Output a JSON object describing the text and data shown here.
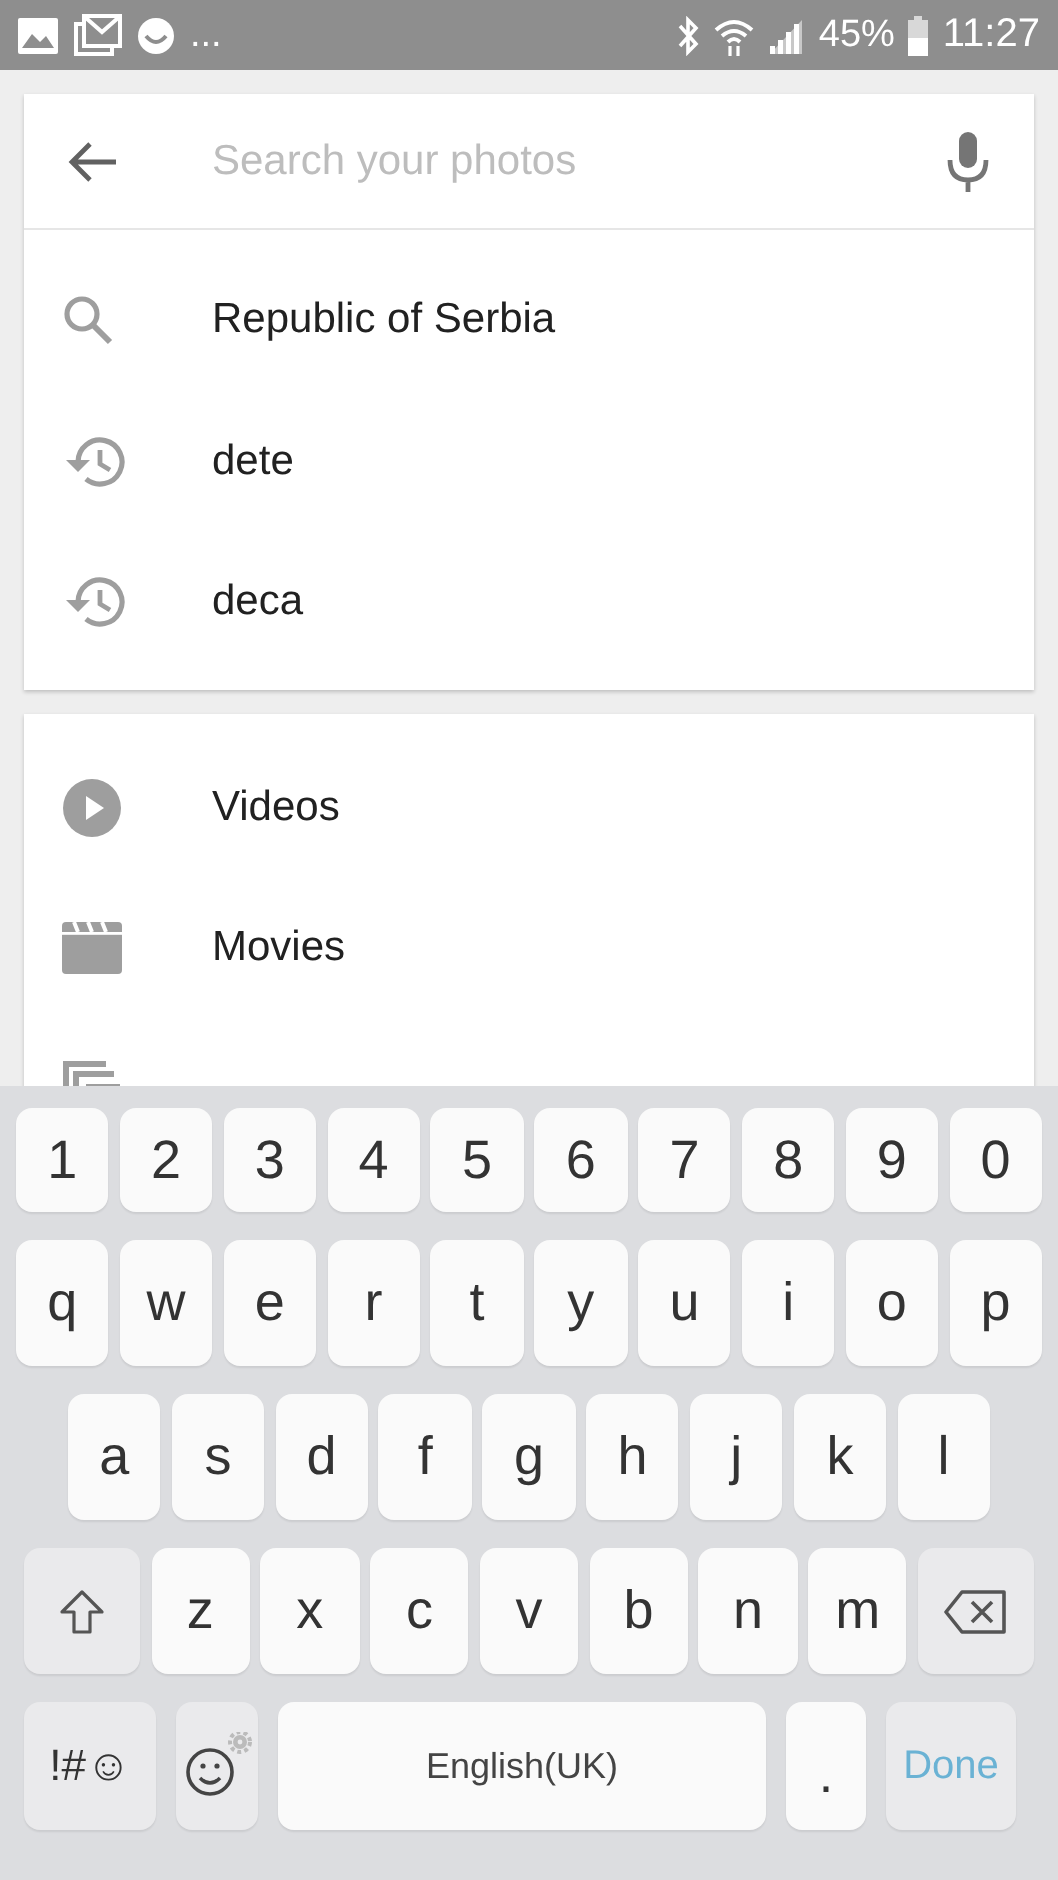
{
  "status_bar": {
    "more": "...",
    "battery": "45%",
    "time": "11:27"
  },
  "search": {
    "placeholder": "Search your photos"
  },
  "suggestions": [
    {
      "kind": "search",
      "text": "Republic of Serbia"
    },
    {
      "kind": "history",
      "text": "dete"
    },
    {
      "kind": "history",
      "text": "deca"
    }
  ],
  "categories": [
    {
      "kind": "video",
      "text": "Videos"
    },
    {
      "kind": "movie",
      "text": "Movies"
    },
    {
      "kind": "animation"
    }
  ],
  "keyboard": {
    "rows": [
      [
        {
          "kind": "char",
          "text": "1"
        },
        {
          "kind": "char",
          "text": "2"
        },
        {
          "kind": "char",
          "text": "3"
        },
        {
          "kind": "char",
          "text": "4"
        },
        {
          "kind": "char",
          "text": "5"
        },
        {
          "kind": "char",
          "text": "6"
        },
        {
          "kind": "char",
          "text": "7"
        },
        {
          "kind": "char",
          "text": "8"
        },
        {
          "kind": "char",
          "text": "9"
        },
        {
          "kind": "char",
          "text": "0"
        }
      ],
      [
        {
          "kind": "char",
          "text": "q"
        },
        {
          "kind": "char",
          "text": "w"
        },
        {
          "kind": "char",
          "text": "e"
        },
        {
          "kind": "char",
          "text": "r"
        },
        {
          "kind": "char",
          "text": "t"
        },
        {
          "kind": "char",
          "text": "y"
        },
        {
          "kind": "char",
          "text": "u"
        },
        {
          "kind": "char",
          "text": "i"
        },
        {
          "kind": "char",
          "text": "o"
        },
        {
          "kind": "char",
          "text": "p"
        }
      ],
      [
        {
          "kind": "char",
          "text": "a"
        },
        {
          "kind": "char",
          "text": "s"
        },
        {
          "kind": "char",
          "text": "d"
        },
        {
          "kind": "char",
          "text": "f"
        },
        {
          "kind": "char",
          "text": "g"
        },
        {
          "kind": "char",
          "text": "h"
        },
        {
          "kind": "char",
          "text": "j"
        },
        {
          "kind": "char",
          "text": "k"
        },
        {
          "kind": "char",
          "text": "l"
        }
      ],
      [
        {
          "kind": "shift"
        },
        {
          "kind": "char",
          "text": "z"
        },
        {
          "kind": "char",
          "text": "x"
        },
        {
          "kind": "char",
          "text": "c"
        },
        {
          "kind": "char",
          "text": "v"
        },
        {
          "kind": "char",
          "text": "b"
        },
        {
          "kind": "char",
          "text": "n"
        },
        {
          "kind": "char",
          "text": "m"
        },
        {
          "kind": "backspace"
        }
      ]
    ],
    "bottom_bar": {
      "symbols_key": "!#☺",
      "space_key": "English(UK)",
      "period_key": ".",
      "done_key": "Done"
    }
  }
}
